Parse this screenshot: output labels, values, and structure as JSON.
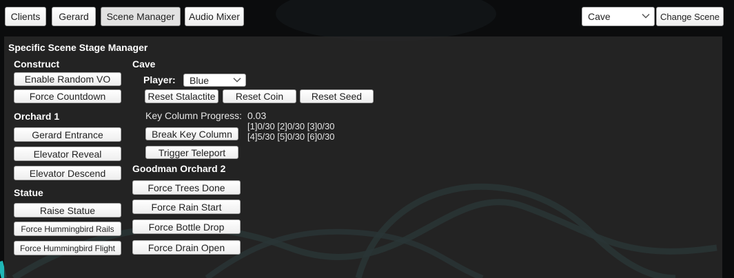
{
  "topbar": {
    "tabs": [
      {
        "label": "Clients"
      },
      {
        "label": "Gerard"
      },
      {
        "label": "Scene Manager"
      },
      {
        "label": "Audio Mixer"
      }
    ],
    "scene_select": {
      "value": "Cave"
    },
    "change_scene_label": "Change Scene"
  },
  "panel": {
    "title": "Specific Scene Stage Manager",
    "construct": {
      "header": "Construct",
      "buttons": [
        "Enable Random VO",
        "Force Countdown"
      ]
    },
    "orchard1": {
      "header": "Orchard 1",
      "buttons": [
        "Gerard Entrance",
        "Elevator Reveal",
        "Elevator Descend"
      ]
    },
    "statue": {
      "header": "Statue",
      "buttons": [
        "Raise Statue",
        "Force Hummingbird Rails",
        "Force Hummingbird Flight"
      ]
    },
    "cave": {
      "header": "Cave",
      "player_label": "Player:",
      "player_value": "Blue",
      "reset_buttons": [
        "Reset Stalactite",
        "Reset Coin",
        "Reset Seed"
      ],
      "key_progress_label": "Key Column Progress:",
      "key_progress_value": "0.03",
      "key_line1": "[1]0/30 [2]0/30 [3]0/30",
      "key_line2": "[4]5/30 [5]0/30 [6]0/30",
      "break_key_label": "Break Key Column",
      "teleport_label": "Trigger Teleport"
    },
    "goodman": {
      "header": "Goodman Orchard 2",
      "buttons": [
        "Force Trees Done",
        "Force Rain Start",
        "Force Bottle Drop",
        "Force Drain Open"
      ]
    }
  },
  "colors": {
    "background": "#0b0c0d",
    "panel": "#282828",
    "teal_lines": "#2f6f72"
  }
}
